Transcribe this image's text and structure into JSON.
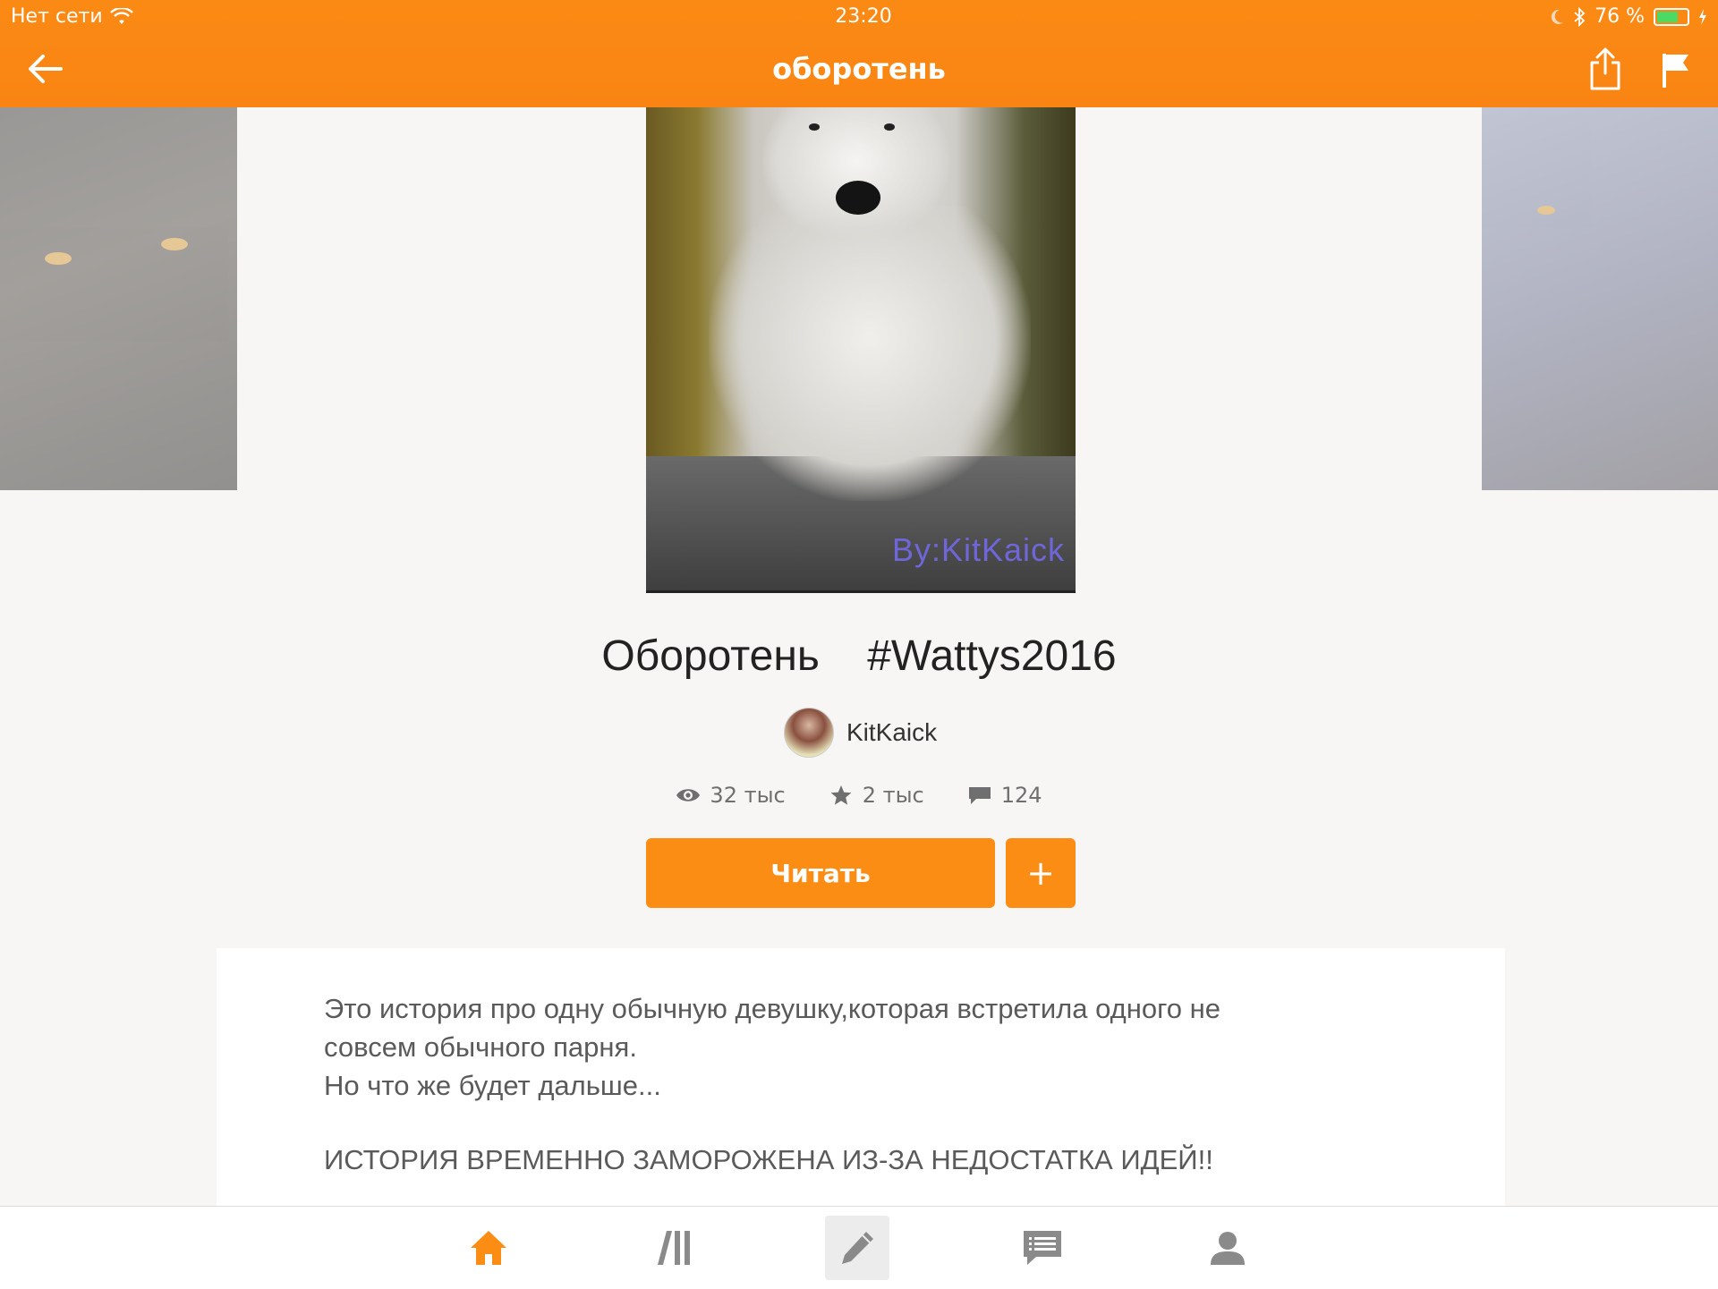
{
  "status_bar": {
    "carrier": "Нет сети",
    "time": "23:20",
    "battery_text": "76 %",
    "battery_level": 0.76
  },
  "nav": {
    "title": "оборотень",
    "back_icon": "arrow-left-icon",
    "share_icon": "share-icon",
    "report_icon": "flag-icon"
  },
  "cover": {
    "signature": "By:KitKaick"
  },
  "story": {
    "title": "Оборотень    #Wattys2016",
    "author": "KitKaick",
    "stats": {
      "reads": "32 тыс",
      "votes": "2 тыс",
      "comments": "124"
    }
  },
  "actions": {
    "read_label": "Читать",
    "add_label": "+"
  },
  "description": {
    "line1": "Это история про одну обычную девушку,которая встретила одного не",
    "line2": "совсем обычного парня.",
    "line3": "Но что же будет дальше...",
    "line4": "ИСТОРИЯ ВРЕМЕННО ЗАМОРОЖЕНА ИЗ-ЗА НЕДОСТАТКА ИДЕЙ!!"
  },
  "tabbar": {
    "items": [
      "home-icon",
      "library-icon",
      "write-icon",
      "messages-icon",
      "profile-icon"
    ],
    "active_color": "#fb8c14",
    "inactive_color": "#8a8a8a"
  },
  "colors": {
    "brand": "#fb8c14",
    "background": "#f8f6f4"
  }
}
